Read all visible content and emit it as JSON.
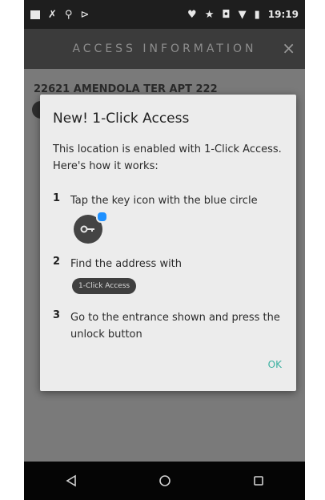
{
  "status_bar": {
    "time": "19:19",
    "left_icons": [
      "image-icon",
      "tool-icon",
      "location-pin-icon",
      "signal-icon"
    ],
    "right_icons": [
      "location-icon",
      "star-icon",
      "vibrate-icon",
      "wifi-icon",
      "signal-icon",
      "battery-icon"
    ]
  },
  "app_bar": {
    "title": "ACCESS INFORMATION",
    "close_label": "×"
  },
  "background": {
    "address": "22621 AMENDOLA TER APT 222"
  },
  "dialog": {
    "title": "New! 1-Click Access",
    "intro": "This location is enabled with 1-Click Access. Here's how it works:",
    "steps": [
      {
        "number": "1",
        "text": "Tap the key icon with the blue circle"
      },
      {
        "number": "2",
        "text": "Find the address with"
      },
      {
        "number": "3",
        "text": "Go to the entrance shown and press the unlock button"
      }
    ],
    "pill_label": "1-Click Access",
    "ok_label": "OK"
  },
  "nav_bar": {
    "icons": [
      "back-icon",
      "home-icon",
      "recents-icon"
    ]
  },
  "colors": {
    "accent": "#3ab0a0",
    "key_dot": "#1e90ff"
  }
}
